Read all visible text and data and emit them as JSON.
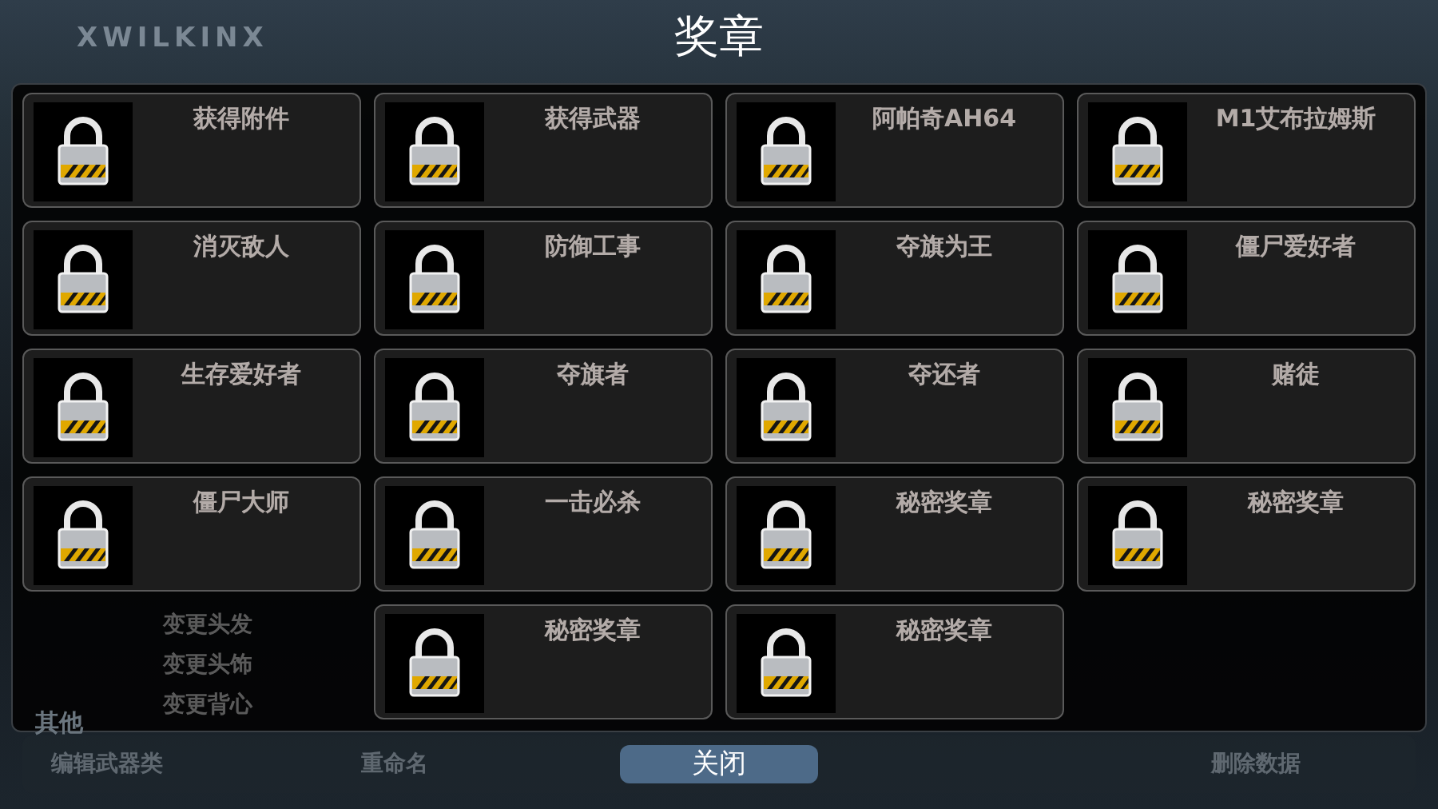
{
  "title": "奖章",
  "background": {
    "logo": "XWILKINX",
    "menu": [
      "变更头发",
      "变更头饰",
      "变更背心"
    ]
  },
  "medals": [
    {
      "name": "获得附件",
      "locked": true
    },
    {
      "name": "获得武器",
      "locked": true
    },
    {
      "name": "阿帕奇AH64",
      "locked": true
    },
    {
      "name": "M1艾布拉姆斯",
      "locked": true
    },
    {
      "name": "消灭敌人",
      "locked": true
    },
    {
      "name": "防御工事",
      "locked": true
    },
    {
      "name": "夺旗为王",
      "locked": true
    },
    {
      "name": "僵尸爱好者",
      "locked": true
    },
    {
      "name": "生存爱好者",
      "locked": true
    },
    {
      "name": "夺旗者",
      "locked": true
    },
    {
      "name": "夺还者",
      "locked": true
    },
    {
      "name": "赌徒",
      "locked": true
    },
    {
      "name": "僵尸大师",
      "locked": true
    },
    {
      "name": "一击必杀",
      "locked": true
    },
    {
      "name": "秘密奖章",
      "locked": true
    },
    {
      "name": "秘密奖章",
      "locked": true
    },
    {
      "name": "秘密奖章",
      "locked": true
    },
    {
      "name": "秘密奖章",
      "locked": true
    }
  ],
  "bottom_bar": {
    "section": "其他",
    "actions": [
      "编辑武器类",
      "重命名",
      "删除数据"
    ]
  },
  "close_button": "关闭"
}
